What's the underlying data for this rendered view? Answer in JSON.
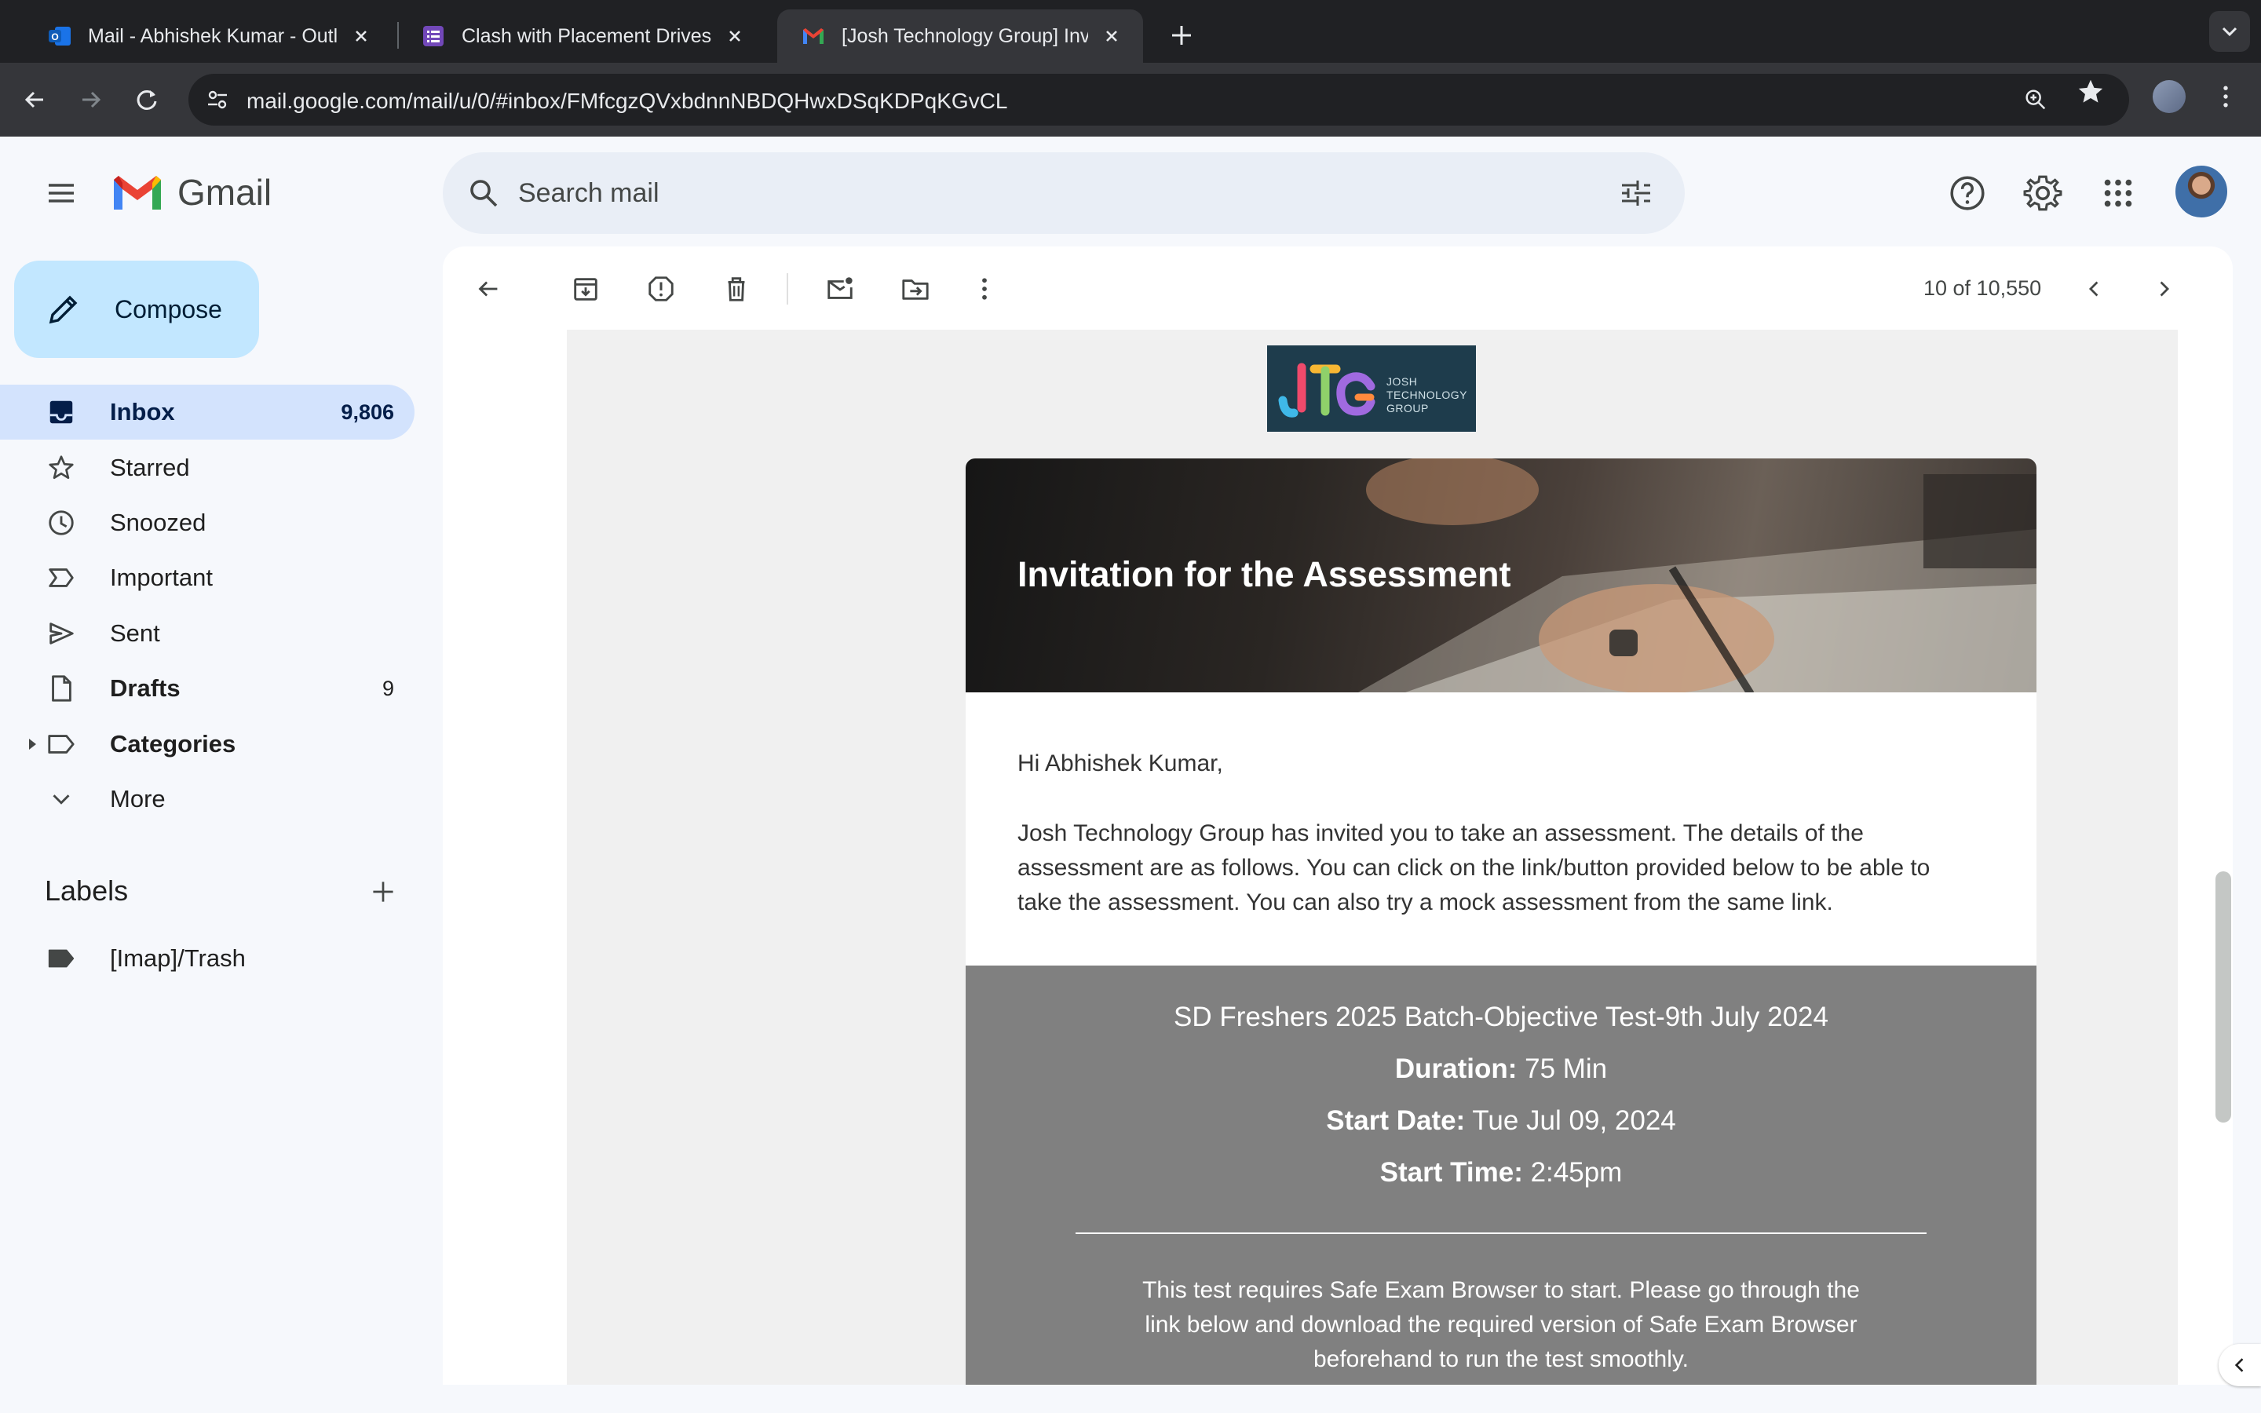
{
  "browser": {
    "tabs": [
      {
        "title": "Mail - Abhishek Kumar - Outlook",
        "icon": "outlook-icon",
        "active": false
      },
      {
        "title": "Clash with Placement Drives - ",
        "icon": "forms-icon",
        "active": false
      },
      {
        "title": "[Josh Technology Group] Invitation",
        "icon": "gmail-icon",
        "active": true
      }
    ],
    "url": "mail.google.com/mail/u/0/#inbox/FMfcgzQVxbdnnNBDQHwxDSqKDPqKGvCL"
  },
  "gmail": {
    "logo_text": "Gmail",
    "search_placeholder": "Search mail",
    "compose_label": "Compose",
    "nav": [
      {
        "label": "Inbox",
        "count": "9,806",
        "icon": "inbox-icon"
      },
      {
        "label": "Starred",
        "count": "",
        "icon": "star-icon"
      },
      {
        "label": "Snoozed",
        "count": "",
        "icon": "clock-icon"
      },
      {
        "label": "Important",
        "count": "",
        "icon": "important-icon"
      },
      {
        "label": "Sent",
        "count": "",
        "icon": "send-icon"
      },
      {
        "label": "Drafts",
        "count": "9",
        "icon": "draft-icon"
      },
      {
        "label": "Categories",
        "count": "",
        "icon": "label-icon"
      },
      {
        "label": "More",
        "count": "",
        "icon": "chevron-down-icon"
      }
    ],
    "labels_heading": "Labels",
    "labels": [
      {
        "label": "[Imap]/Trash",
        "icon": "label-filled-icon"
      }
    ],
    "pager": "10 of 10,550"
  },
  "email": {
    "logo_text": "JOSH TECHNOLOGY GROUP",
    "hero_title": "Invitation for the Assessment",
    "greeting": "Hi Abhishek Kumar,",
    "intro": "Josh Technology Group has invited you to take an assessment. The details of the assessment are as follows. You can click on the link/button provided below to be able to take the assessment. You can also try a mock assessment from the same link.",
    "test_name": "SD Freshers 2025 Batch-Objective Test-9th July 2024",
    "duration_label": "Duration:",
    "duration_value": " 75 Min",
    "start_date_label": "Start Date:",
    "start_date_value": " Tue Jul 09, 2024",
    "start_time_label": "Start Time:",
    "start_time_value": " 2:45pm",
    "seb_note": "This test requires Safe Exam Browser to start. Please go through the link below and download the required version of Safe Exam Browser beforehand to run the test smoothly."
  },
  "colors": {
    "compose_bg": "#c2e7ff",
    "inbox_selected": "#d3e3fd",
    "details_bg": "#808080"
  }
}
